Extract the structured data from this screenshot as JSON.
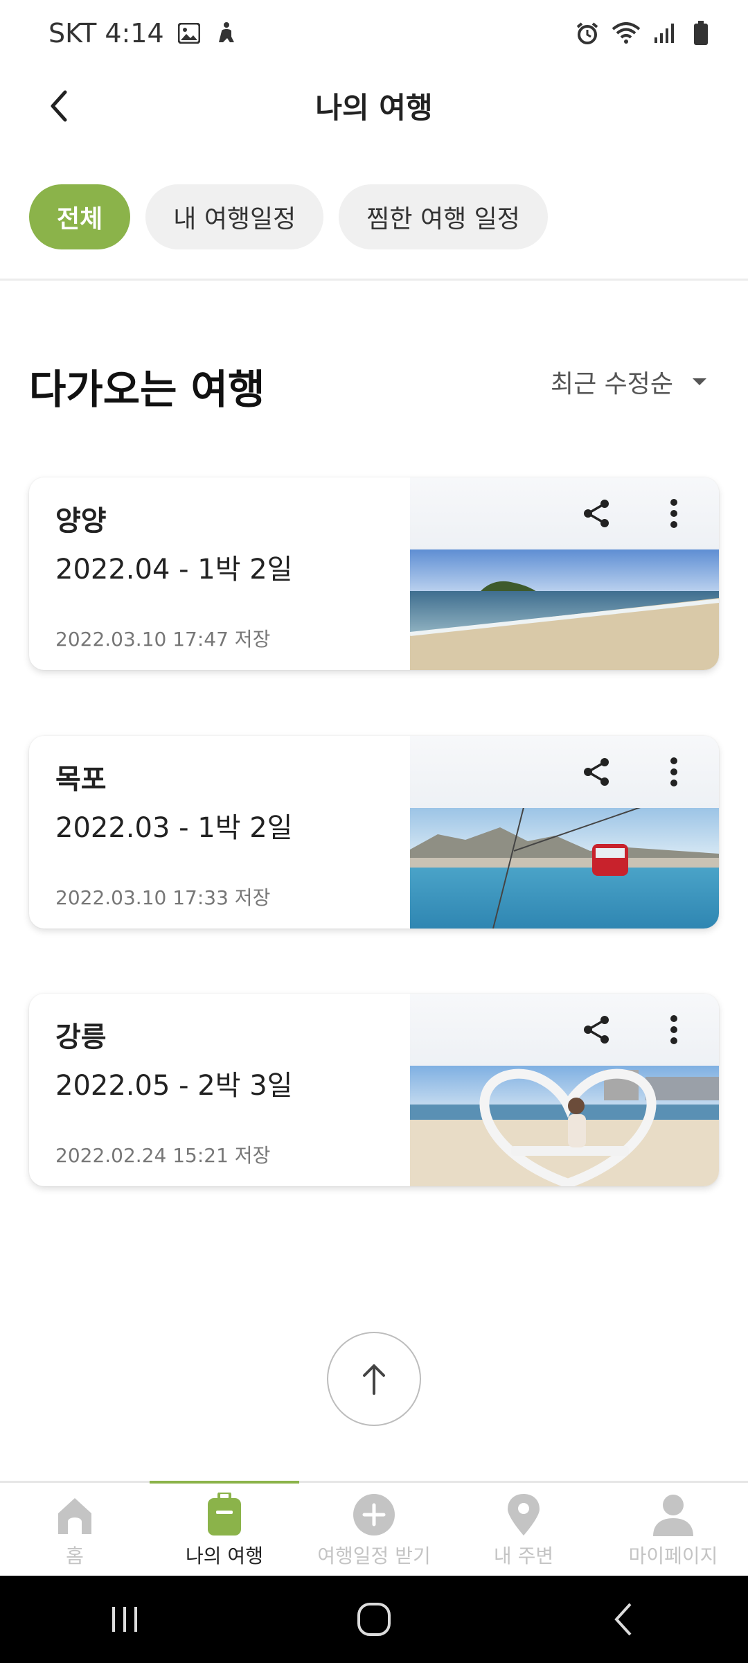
{
  "status_bar": {
    "carrier": "SKT",
    "time": "4:14",
    "icons": [
      "gallery-icon",
      "accessibility-icon",
      "alarm-icon",
      "wifi-icon",
      "signal-icon",
      "battery-icon"
    ]
  },
  "header": {
    "title": "나의 여행",
    "back_icon": "chevron-left-icon"
  },
  "filters": {
    "items": [
      {
        "label": "전체",
        "active": true
      },
      {
        "label": "내 여행일정",
        "active": false
      },
      {
        "label": "찜한 여행 일정",
        "active": false
      }
    ]
  },
  "section": {
    "title": "다가오는 여행",
    "sort_label": "최근 수정순"
  },
  "trips": [
    {
      "name": "양양",
      "period": "2022.04 - 1박 2일",
      "saved": "2022.03.10  17:47  저장",
      "photo": "beach-island"
    },
    {
      "name": "목포",
      "period": "2022.03 - 1박 2일",
      "saved": "2022.03.10  17:33  저장",
      "photo": "cable-car-harbor"
    },
    {
      "name": "강릉",
      "period": "2022.05 - 2박 3일",
      "saved": "2022.02.24  15:21  저장",
      "photo": "beach-heart-bench"
    }
  ],
  "bottom_nav": {
    "items": [
      {
        "label": "홈",
        "icon": "home-icon",
        "active": false
      },
      {
        "label": "나의 여행",
        "icon": "suitcase-icon",
        "active": true
      },
      {
        "label": "여행일정 받기",
        "icon": "plus-circle-icon",
        "active": false
      },
      {
        "label": "내 주변",
        "icon": "location-pin-icon",
        "active": false
      },
      {
        "label": "마이페이지",
        "icon": "person-icon",
        "active": false
      }
    ]
  },
  "colors": {
    "accent": "#8bb34a",
    "chip_bg": "#f0f0f0",
    "inactive_nav": "#c4c4c4"
  }
}
